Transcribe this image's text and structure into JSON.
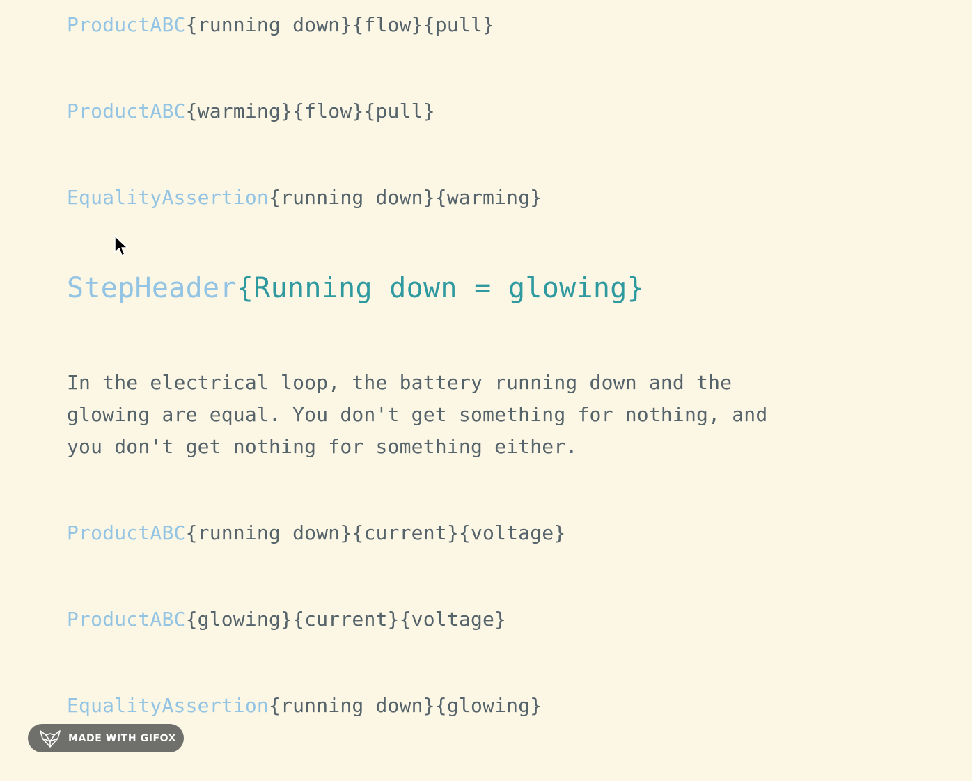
{
  "colors": {
    "background": "#fcf6e4",
    "keyword": "#93c4e3",
    "text": "#55636b",
    "header_args": "#2e9aa0",
    "badge_bg": "#6f6f6c"
  },
  "lines": [
    {
      "keyword": "ProductABC",
      "args": "{running down}{flow}{pull}"
    },
    {
      "keyword": "ProductABC",
      "args": "{warming}{flow}{pull}"
    },
    {
      "keyword": "EqualityAssertion",
      "args": "{running down}{warming}"
    }
  ],
  "step_header": {
    "keyword": "StepHeader",
    "args": "{Running down = glowing}"
  },
  "paragraph": {
    "lines": [
      "In the electrical loop, the battery running down and the",
      "glowing are equal. You don't get something for nothing, and",
      "you don't get nothing for something either."
    ]
  },
  "lines_after": [
    {
      "keyword": "ProductABC",
      "args": "{running down}{current}{voltage}"
    },
    {
      "keyword": "ProductABC",
      "args": "{glowing}{current}{voltage}"
    },
    {
      "keyword": "EqualityAssertion",
      "args": "{running down}{glowing}"
    }
  ],
  "badge": {
    "icon": "fox-icon",
    "label": "MADE WITH GIFOX"
  },
  "cursor": {
    "icon": "mouse-pointer-icon"
  }
}
